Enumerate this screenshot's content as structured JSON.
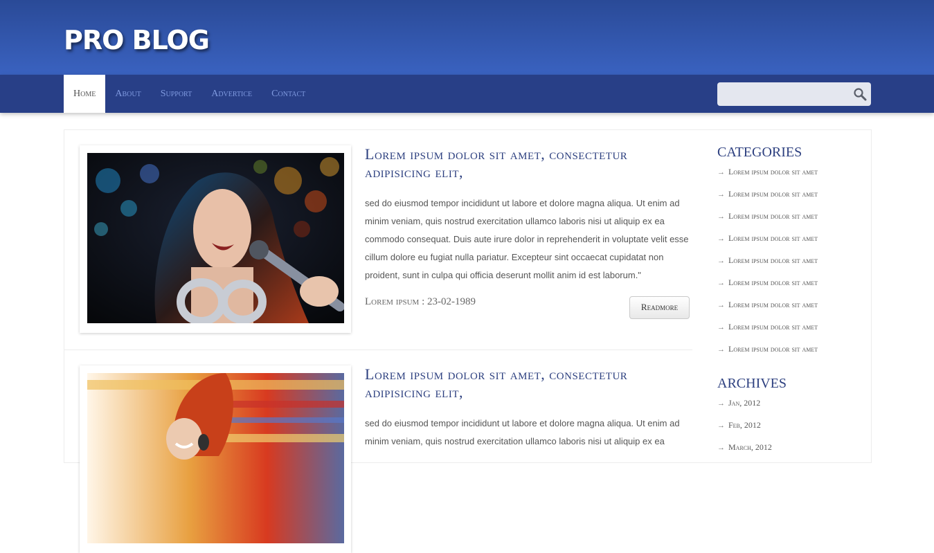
{
  "header": {
    "logo": "PRO BLOG"
  },
  "nav": {
    "items": [
      {
        "label": "Home",
        "active": true
      },
      {
        "label": "About"
      },
      {
        "label": "Support"
      },
      {
        "label": "Advertice"
      },
      {
        "label": "Contact"
      }
    ],
    "search_placeholder": ""
  },
  "posts": [
    {
      "title": "Lorem ipsum dolor sit amet, consectetur adipisicing elit,",
      "text": "sed do eiusmod tempor incididunt ut labore et dolore magna aliqua. Ut enim ad minim veniam, quis nostrud exercitation ullamco laboris nisi ut aliquip ex ea commodo consequat. Duis aute irure dolor in reprehenderit in voluptate velit esse cillum dolore eu fugiat nulla pariatur. Excepteur sint occaecat cupidatat non proident, sunt in culpa qui officia deserunt mollit anim id est laborum.\"",
      "meta": "Lorem ipsum : 23-02-1989",
      "readmore": "Readmore"
    },
    {
      "title": "Lorem ipsum dolor sit amet, consectetur adipisicing elit,",
      "text": "sed do eiusmod tempor incididunt ut labore et dolore magna aliqua. Ut enim ad minim veniam, quis nostrud exercitation ullamco laboris nisi ut aliquip ex ea"
    }
  ],
  "sidebar": {
    "categories_title": "CATEGORIES",
    "categories": [
      "Lorem ipsum dolor sit amet",
      "Lorem ipsum dolor sit amet",
      "Lorem ipsum dolor sit amet",
      "Lorem ipsum dolor sit amet",
      "Lorem ipsum dolor sit amet",
      "Lorem ipsum dolor sit amet",
      "Lorem ipsum dolor sit amet",
      "Lorem ipsum dolor sit amet",
      "Lorem ipsum dolor sit amet"
    ],
    "archives_title": "ARCHIVES",
    "archives": [
      "Jan, 2012",
      "Feb, 2012",
      "March, 2012"
    ],
    "arrow_icon": "arrow-right-icon"
  }
}
